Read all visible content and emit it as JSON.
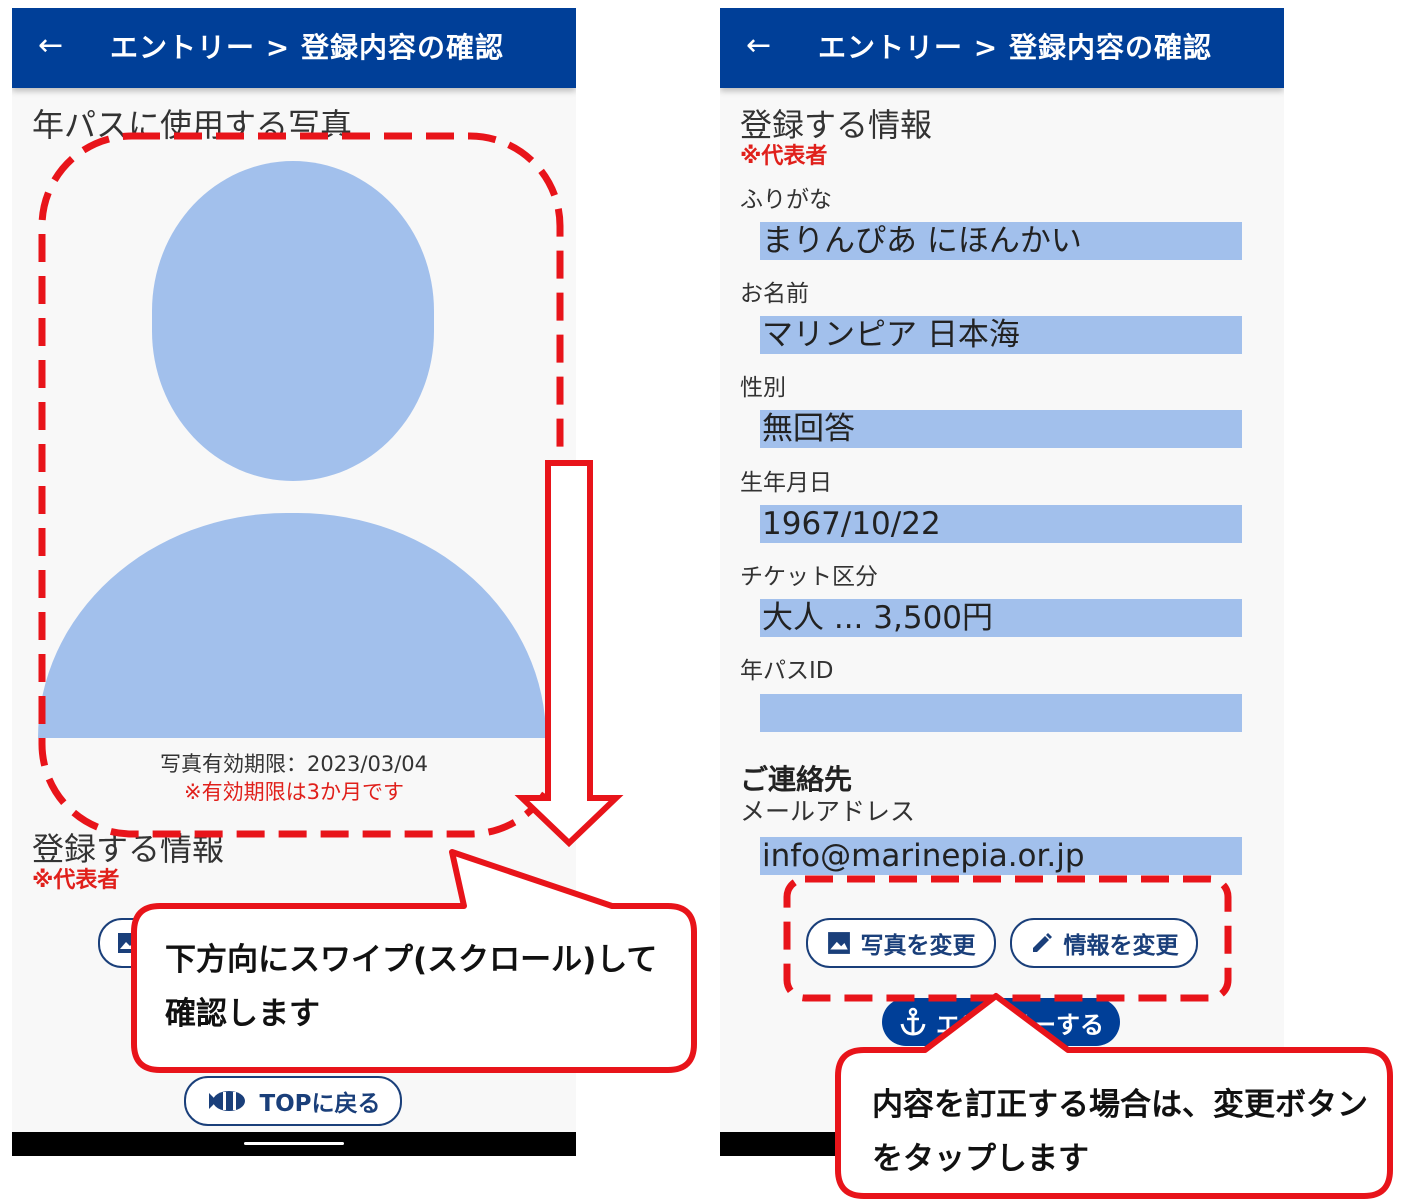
{
  "left_screen": {
    "appbar": {
      "back_icon": "←",
      "title": "エントリー > 登録内容の確認"
    },
    "photo_title": "年パスに使用する写真",
    "photo_expiry": "写真有効期限：2023/03/04",
    "photo_note": "※有効期限は3か月です",
    "info_title": "登録する情報",
    "rep_label": "※代表者",
    "top_button": "TOPに戻る"
  },
  "right_screen": {
    "appbar": {
      "back_icon": "←",
      "title": "エントリー > 登録内容の確認"
    },
    "info_title": "登録する情報",
    "rep_label": "※代表者",
    "fields": [
      {
        "label": "ふりがな",
        "value": "まりんぴあ にほんかい"
      },
      {
        "label": "お名前",
        "value": "マリンピア 日本海"
      },
      {
        "label": "性別",
        "value": "無回答"
      },
      {
        "label": "生年月日",
        "value": "1967/10/22"
      },
      {
        "label": "チケット区分",
        "value": "大人 ... 3,500円"
      },
      {
        "label": "年パスID",
        "value": ""
      }
    ],
    "contact_title": "ご連絡先",
    "email_label": "メールアドレス",
    "email_value": "info@marinepia.or.jp",
    "photo_change_button": "写真を変更",
    "info_change_button": "情報を変更",
    "entry_button": "エントリーする"
  },
  "annotations": {
    "swipe_callout_line1": "下方向にスワイプ(スクロール)して",
    "swipe_callout_line2": "確認します",
    "change_callout_line1": "内容を訂正する場合は、変更ボタン",
    "change_callout_line2": "をタップします"
  },
  "colors": {
    "appbar": "#003f98",
    "placeholder": "#a2c0ec",
    "annotation_red": "#e8141a",
    "required_red": "#e0201b"
  }
}
